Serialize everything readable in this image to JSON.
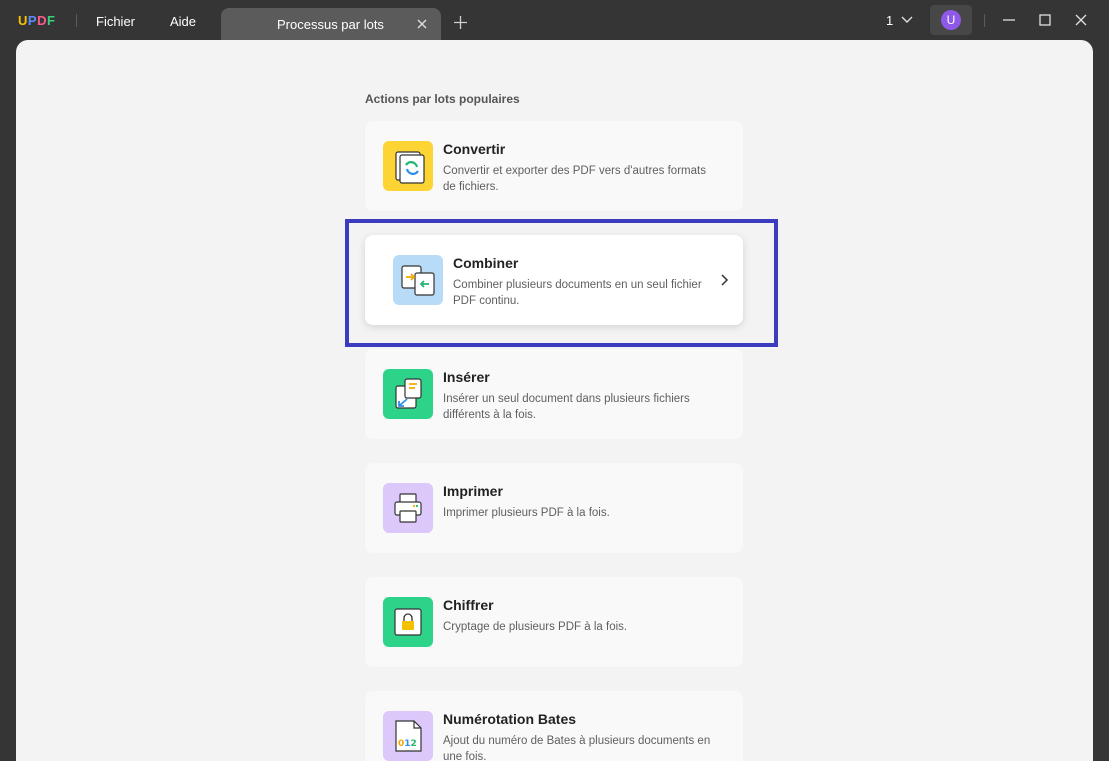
{
  "app": {
    "logo_letters": [
      "U",
      "P",
      "D",
      "F"
    ],
    "logo_colors": [
      "#f5c400",
      "#5a8cff",
      "#ff5a8c",
      "#38d07a"
    ],
    "menu": [
      "Fichier",
      "Aide"
    ],
    "tab_title": "Processus par lots",
    "page_count": "1",
    "avatar_letter": "U",
    "accent": "#8e59e8"
  },
  "main": {
    "section_title": "Actions par lots populaires",
    "cards": [
      {
        "title": "Convertir",
        "desc": "Convertir et exporter des PDF vers d'autres formats de fichiers.",
        "icon": "convert-icon",
        "color": "#fcd535"
      },
      {
        "title": "Combiner",
        "desc": "Combiner plusieurs documents en un seul fichier PDF continu.",
        "icon": "combine-icon",
        "color": "#b8dcf7"
      },
      {
        "title": "Insérer",
        "desc": "Insérer un seul document dans plusieurs fichiers différents à la fois.",
        "icon": "insert-icon",
        "color": "#2ed38a"
      },
      {
        "title": "Imprimer",
        "desc": "Imprimer plusieurs PDF à la fois.",
        "icon": "print-icon",
        "color": "#dcc8fa"
      },
      {
        "title": "Chiffrer",
        "desc": "Cryptage de plusieurs PDF à la fois.",
        "icon": "lock-icon",
        "color": "#2ed38a"
      },
      {
        "title": "Numérotation Bates",
        "desc": "Ajout du numéro de Bates à plusieurs documents en une fois.",
        "icon": "bates-icon",
        "color": "#dcc8fa"
      }
    ],
    "highlight_color": "#3b3bbf"
  }
}
